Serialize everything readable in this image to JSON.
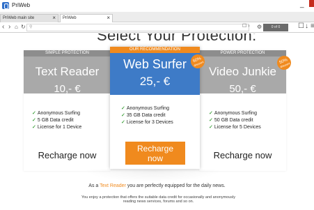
{
  "window": {
    "title": "PriWeb"
  },
  "tabs": [
    {
      "label": "PriWeb main site"
    },
    {
      "label": "PriWeb"
    }
  ],
  "navbar": {
    "url": "",
    "find_label": "0 of 0"
  },
  "page": {
    "headline": "Select Your Protection:",
    "plans": [
      {
        "label": "SIMPLE PROTECTION",
        "name": "Text Reader",
        "price": "10,- €",
        "features": [
          "Anonymous Surfing",
          "5 GB Data credit",
          "License for 1 Device"
        ],
        "cta": "Recharge now"
      },
      {
        "label": "OUR RECOMMENDATION",
        "name": "Web Surfer",
        "price": "25,- €",
        "badge_pct": "60%",
        "badge_word": "discount",
        "features": [
          "Anonymous Surfing",
          "35 GB Data credit",
          "License for 3 Devices"
        ],
        "cta_line1": "Recharge",
        "cta_line2": "now"
      },
      {
        "label": "POWER PROTECTION",
        "name": "Video Junkie",
        "price": "50,- €",
        "badge_pct": "50%",
        "badge_word": "discount",
        "features": [
          "Anonymous Surfing",
          "50 GB Data credit",
          "License for 5 Devices"
        ],
        "cta": "Recharge now"
      }
    ],
    "info": {
      "prefix": "As a ",
      "highlight": "Text Reader",
      "suffix": " you are perfectly equipped for the daily news.",
      "detail": "You enjoy a protection that offers the suitable data credit for occasionally and anonymously reading news services, forums and so on."
    }
  },
  "colors": {
    "accent": "#f08a1e",
    "blue": "#3e7bc7",
    "grey": "#a9a9a9",
    "check": "#4ca84a"
  }
}
